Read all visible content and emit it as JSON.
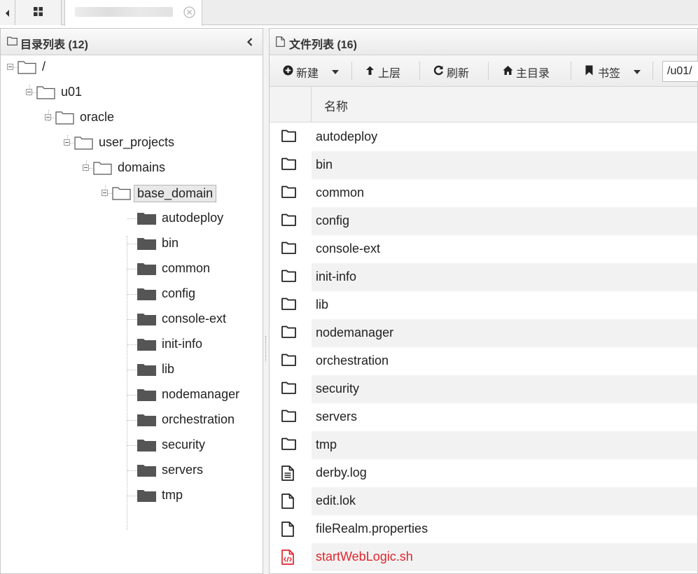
{
  "tree_panel": {
    "title": "目录列表 (12)",
    "nodes": [
      {
        "label": "/"
      },
      {
        "label": "u01"
      },
      {
        "label": "oracle"
      },
      {
        "label": "user_projects"
      },
      {
        "label": "domains"
      },
      {
        "label": "base_domain"
      },
      {
        "label": "autodeploy"
      },
      {
        "label": "bin"
      },
      {
        "label": "common"
      },
      {
        "label": "config"
      },
      {
        "label": "console-ext"
      },
      {
        "label": "init-info"
      },
      {
        "label": "lib"
      },
      {
        "label": "nodemanager"
      },
      {
        "label": "orchestration"
      },
      {
        "label": "security"
      },
      {
        "label": "servers"
      },
      {
        "label": "tmp"
      }
    ]
  },
  "file_panel": {
    "title": "文件列表 (16)",
    "toolbar": {
      "new_label": "新建",
      "up_label": "上层",
      "refresh_label": "刷新",
      "home_label": "主目录",
      "bookmark_label": "书签",
      "path_value": "/u01/"
    },
    "column_name": "名称",
    "files": [
      {
        "name": "autodeploy",
        "icon": "folder-icon"
      },
      {
        "name": "bin",
        "icon": "folder-icon"
      },
      {
        "name": "common",
        "icon": "folder-icon"
      },
      {
        "name": "config",
        "icon": "folder-icon"
      },
      {
        "name": "console-ext",
        "icon": "folder-icon"
      },
      {
        "name": "init-info",
        "icon": "folder-icon"
      },
      {
        "name": "lib",
        "icon": "folder-icon"
      },
      {
        "name": "nodemanager",
        "icon": "folder-icon"
      },
      {
        "name": "orchestration",
        "icon": "folder-icon"
      },
      {
        "name": "security",
        "icon": "folder-icon"
      },
      {
        "name": "servers",
        "icon": "folder-icon"
      },
      {
        "name": "tmp",
        "icon": "folder-icon"
      },
      {
        "name": "derby.log",
        "icon": "text-file-icon"
      },
      {
        "name": "edit.lok",
        "icon": "file-icon"
      },
      {
        "name": "fileRealm.properties",
        "icon": "file-icon"
      },
      {
        "name": "startWebLogic.sh",
        "icon": "code-file-icon"
      }
    ]
  },
  "colors": {
    "script_file": "#e0262c",
    "alt_row": "#f2f2f2"
  }
}
